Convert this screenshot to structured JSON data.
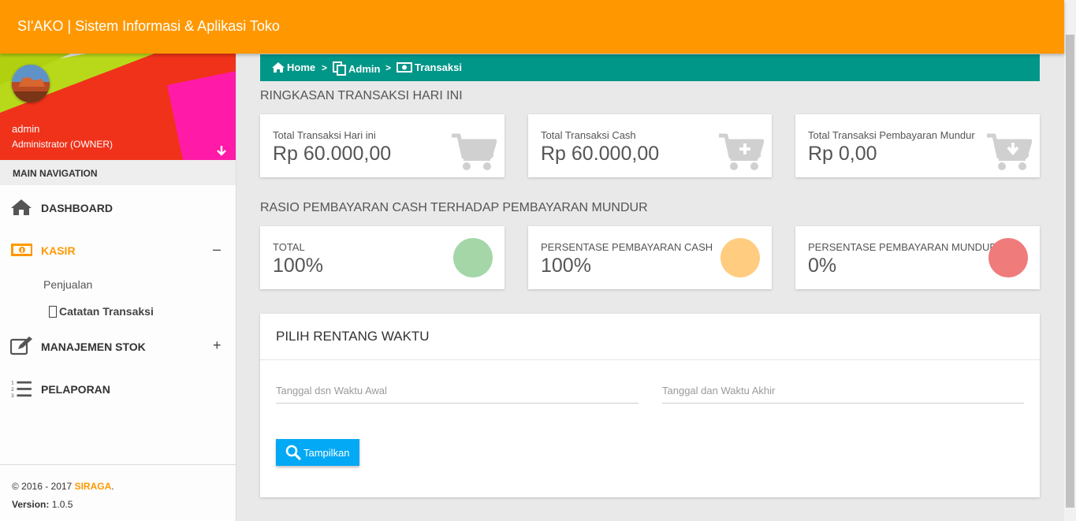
{
  "topbar": {
    "title": "SI'AKO | Sistem Informasi & Aplikasi Toko",
    "color": "#ff9800"
  },
  "profile": {
    "name": "admin",
    "role": "Administrator (OWNER)"
  },
  "sidebar": {
    "header": "MAIN NAVIGATION",
    "items": [
      {
        "label": "DASHBOARD",
        "icon": "home-icon"
      },
      {
        "label": "KASIR",
        "icon": "money-icon",
        "toggle": "–",
        "active": true
      },
      {
        "label": "MANAJEMEN STOK",
        "icon": "edit-icon",
        "toggle": "+"
      },
      {
        "label": "PELAPORAN",
        "icon": "list-ol-icon"
      }
    ],
    "kasir_sub": [
      "Penjualan",
      "Catatan Transaksi"
    ]
  },
  "footer": {
    "copyright": "© 2016 - 2017",
    "brand": "SIRAGA",
    "dot": ".",
    "version_label": "Version:",
    "version": "1.0.5"
  },
  "breadcrumb": [
    "Home",
    "Admin",
    "Transaksi"
  ],
  "breadcrumb_sep": ">",
  "summary": {
    "title": "RINGKASAN TRANSAKSI HARI INI",
    "cards": [
      {
        "label": "Total Transaksi Hari ini",
        "value": "Rp 60.000,00",
        "icon": "cart-icon"
      },
      {
        "label": "Total Transaksi Cash",
        "value": "Rp 60.000,00",
        "icon": "cart-plus-icon"
      },
      {
        "label": "Total Transaksi Pembayaran Mundur",
        "value": "Rp 0,00",
        "icon": "cart-download-icon"
      }
    ]
  },
  "ratio": {
    "title": "RASIO PEMBAYARAN CASH TERHADAP PEMBAYARAN MUNDUR",
    "cards": [
      {
        "label": "TOTAL",
        "value": "100%",
        "color": "#a5d6a7"
      },
      {
        "label": "PERSENTASE PEMBAYARAN CASH",
        "value": "100%",
        "color": "#ffcc80"
      },
      {
        "label": "PERSENTASE PEMBAYARAN MUNDUR",
        "value": "0%",
        "color": "#ef7b7b"
      }
    ]
  },
  "range": {
    "title": "PILIH RENTANG WAKTU",
    "start_placeholder": "Tanggal dsn Waktu Awal",
    "end_placeholder": "Tanggal dan Waktu Akhir",
    "button": "Tampilkan"
  },
  "colors": {
    "teal": "#009688",
    "blue": "#03a9f4",
    "orange": "#ff9800"
  }
}
